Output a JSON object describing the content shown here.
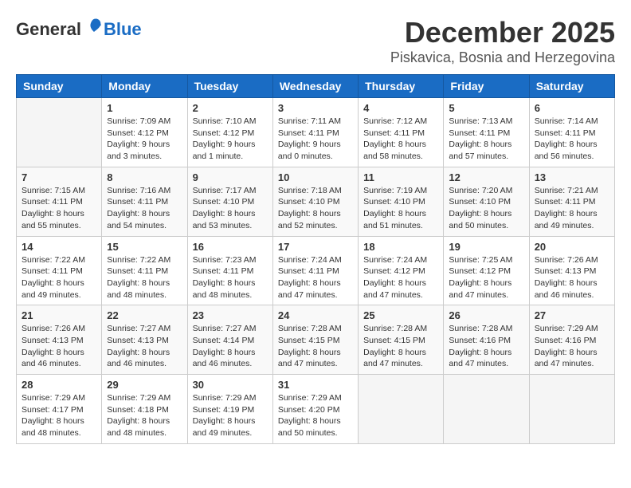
{
  "logo": {
    "general": "General",
    "blue": "Blue"
  },
  "title": "December 2025",
  "location": "Piskavica, Bosnia and Herzegovina",
  "days_of_week": [
    "Sunday",
    "Monday",
    "Tuesday",
    "Wednesday",
    "Thursday",
    "Friday",
    "Saturday"
  ],
  "weeks": [
    [
      {
        "day": "",
        "info": ""
      },
      {
        "day": "1",
        "info": "Sunrise: 7:09 AM\nSunset: 4:12 PM\nDaylight: 9 hours\nand 3 minutes."
      },
      {
        "day": "2",
        "info": "Sunrise: 7:10 AM\nSunset: 4:12 PM\nDaylight: 9 hours\nand 1 minute."
      },
      {
        "day": "3",
        "info": "Sunrise: 7:11 AM\nSunset: 4:11 PM\nDaylight: 9 hours\nand 0 minutes."
      },
      {
        "day": "4",
        "info": "Sunrise: 7:12 AM\nSunset: 4:11 PM\nDaylight: 8 hours\nand 58 minutes."
      },
      {
        "day": "5",
        "info": "Sunrise: 7:13 AM\nSunset: 4:11 PM\nDaylight: 8 hours\nand 57 minutes."
      },
      {
        "day": "6",
        "info": "Sunrise: 7:14 AM\nSunset: 4:11 PM\nDaylight: 8 hours\nand 56 minutes."
      }
    ],
    [
      {
        "day": "7",
        "info": "Sunrise: 7:15 AM\nSunset: 4:11 PM\nDaylight: 8 hours\nand 55 minutes."
      },
      {
        "day": "8",
        "info": "Sunrise: 7:16 AM\nSunset: 4:11 PM\nDaylight: 8 hours\nand 54 minutes."
      },
      {
        "day": "9",
        "info": "Sunrise: 7:17 AM\nSunset: 4:10 PM\nDaylight: 8 hours\nand 53 minutes."
      },
      {
        "day": "10",
        "info": "Sunrise: 7:18 AM\nSunset: 4:10 PM\nDaylight: 8 hours\nand 52 minutes."
      },
      {
        "day": "11",
        "info": "Sunrise: 7:19 AM\nSunset: 4:10 PM\nDaylight: 8 hours\nand 51 minutes."
      },
      {
        "day": "12",
        "info": "Sunrise: 7:20 AM\nSunset: 4:10 PM\nDaylight: 8 hours\nand 50 minutes."
      },
      {
        "day": "13",
        "info": "Sunrise: 7:21 AM\nSunset: 4:11 PM\nDaylight: 8 hours\nand 49 minutes."
      }
    ],
    [
      {
        "day": "14",
        "info": "Sunrise: 7:22 AM\nSunset: 4:11 PM\nDaylight: 8 hours\nand 49 minutes."
      },
      {
        "day": "15",
        "info": "Sunrise: 7:22 AM\nSunset: 4:11 PM\nDaylight: 8 hours\nand 48 minutes."
      },
      {
        "day": "16",
        "info": "Sunrise: 7:23 AM\nSunset: 4:11 PM\nDaylight: 8 hours\nand 48 minutes."
      },
      {
        "day": "17",
        "info": "Sunrise: 7:24 AM\nSunset: 4:11 PM\nDaylight: 8 hours\nand 47 minutes."
      },
      {
        "day": "18",
        "info": "Sunrise: 7:24 AM\nSunset: 4:12 PM\nDaylight: 8 hours\nand 47 minutes."
      },
      {
        "day": "19",
        "info": "Sunrise: 7:25 AM\nSunset: 4:12 PM\nDaylight: 8 hours\nand 47 minutes."
      },
      {
        "day": "20",
        "info": "Sunrise: 7:26 AM\nSunset: 4:13 PM\nDaylight: 8 hours\nand 46 minutes."
      }
    ],
    [
      {
        "day": "21",
        "info": "Sunrise: 7:26 AM\nSunset: 4:13 PM\nDaylight: 8 hours\nand 46 minutes."
      },
      {
        "day": "22",
        "info": "Sunrise: 7:27 AM\nSunset: 4:13 PM\nDaylight: 8 hours\nand 46 minutes."
      },
      {
        "day": "23",
        "info": "Sunrise: 7:27 AM\nSunset: 4:14 PM\nDaylight: 8 hours\nand 46 minutes."
      },
      {
        "day": "24",
        "info": "Sunrise: 7:28 AM\nSunset: 4:15 PM\nDaylight: 8 hours\nand 47 minutes."
      },
      {
        "day": "25",
        "info": "Sunrise: 7:28 AM\nSunset: 4:15 PM\nDaylight: 8 hours\nand 47 minutes."
      },
      {
        "day": "26",
        "info": "Sunrise: 7:28 AM\nSunset: 4:16 PM\nDaylight: 8 hours\nand 47 minutes."
      },
      {
        "day": "27",
        "info": "Sunrise: 7:29 AM\nSunset: 4:16 PM\nDaylight: 8 hours\nand 47 minutes."
      }
    ],
    [
      {
        "day": "28",
        "info": "Sunrise: 7:29 AM\nSunset: 4:17 PM\nDaylight: 8 hours\nand 48 minutes."
      },
      {
        "day": "29",
        "info": "Sunrise: 7:29 AM\nSunset: 4:18 PM\nDaylight: 8 hours\nand 48 minutes."
      },
      {
        "day": "30",
        "info": "Sunrise: 7:29 AM\nSunset: 4:19 PM\nDaylight: 8 hours\nand 49 minutes."
      },
      {
        "day": "31",
        "info": "Sunrise: 7:29 AM\nSunset: 4:20 PM\nDaylight: 8 hours\nand 50 minutes."
      },
      {
        "day": "",
        "info": ""
      },
      {
        "day": "",
        "info": ""
      },
      {
        "day": "",
        "info": ""
      }
    ]
  ]
}
